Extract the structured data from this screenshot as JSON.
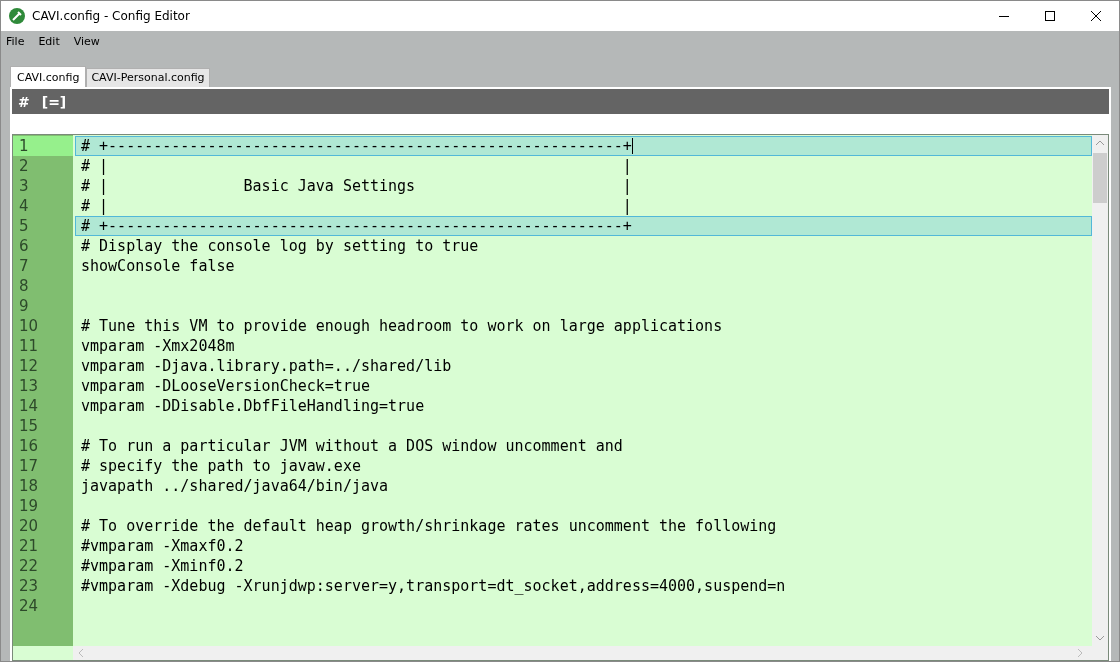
{
  "window": {
    "title": "CAVI.config - Config Editor"
  },
  "menu": [
    "File",
    "Edit",
    "View"
  ],
  "tabs": [
    {
      "label": "CAVI.config",
      "selected": true
    },
    {
      "label": "CAVI-Personal.config",
      "selected": false
    }
  ],
  "toolbar": [
    "#",
    "[=]"
  ],
  "lines": [
    {
      "number": "1",
      "text": "# +---------------------------------------------------------+",
      "selected": true,
      "highlighted": true
    },
    {
      "number": "2",
      "text": "# |                                                         |",
      "selected": false,
      "highlighted": false
    },
    {
      "number": "3",
      "text": "# |               Basic Java Settings                       |",
      "selected": false,
      "highlighted": false
    },
    {
      "number": "4",
      "text": "# |                                                         |",
      "selected": false,
      "highlighted": false
    },
    {
      "number": "5",
      "text": "# +---------------------------------------------------------+",
      "selected": false,
      "highlighted": true
    },
    {
      "number": "6",
      "text": "# Display the console log by setting to true",
      "selected": false,
      "highlighted": false
    },
    {
      "number": "7",
      "text": "showConsole false",
      "selected": false,
      "highlighted": false
    },
    {
      "number": "8",
      "selected": false,
      "highlighted": false
    },
    {
      "number": "9",
      "selected": false,
      "highlighted": false
    },
    {
      "number": "10",
      "text": "# Tune this VM to provide enough headroom to work on large applications",
      "selected": false,
      "highlighted": false
    },
    {
      "number": "11",
      "text": "vmparam -Xmx2048m",
      "selected": false,
      "highlighted": false
    },
    {
      "number": "12",
      "text": "vmparam -Djava.library.path=../shared/lib",
      "selected": false,
      "highlighted": false
    },
    {
      "number": "13",
      "text": "vmparam -DLooseVersionCheck=true",
      "selected": false,
      "highlighted": false
    },
    {
      "number": "14",
      "text": "vmparam -DDisable.DbfFileHandling=true",
      "selected": false,
      "highlighted": false
    },
    {
      "number": "15",
      "selected": false,
      "highlighted": false
    },
    {
      "number": "16",
      "text": "# To run a particular JVM without a DOS window uncomment and",
      "selected": false,
      "highlighted": false
    },
    {
      "number": "17",
      "text": "# specify the path to javaw.exe",
      "selected": false,
      "highlighted": false
    },
    {
      "number": "18",
      "text": "javapath ../shared/java64/bin/java",
      "selected": false,
      "highlighted": false
    },
    {
      "number": "19",
      "selected": false,
      "highlighted": false
    },
    {
      "number": "20",
      "text": "# To override the default heap growth/shrinkage rates uncomment the following",
      "selected": false,
      "highlighted": false
    },
    {
      "number": "21",
      "text": "#vmparam -Xmaxf0.2",
      "selected": false,
      "highlighted": false
    },
    {
      "number": "22",
      "text": "#vmparam -Xminf0.2",
      "selected": false,
      "highlighted": false
    },
    {
      "number": "23",
      "text": "#vmparam -Xdebug -Xrunjdwp:server=y,transport=dt_socket,address=4000,suspend=n",
      "selected": false,
      "highlighted": false
    },
    {
      "number": "24",
      "selected": false,
      "highlighted": false
    }
  ]
}
